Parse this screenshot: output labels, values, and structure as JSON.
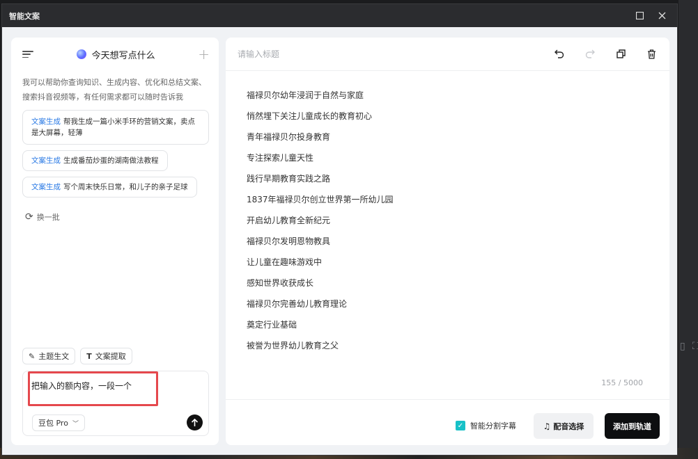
{
  "window": {
    "title": "智能文案"
  },
  "left": {
    "header_title": "今天想写点什么",
    "intro": "我可以帮助你查询知识、生成内容、优化和总结文案、搜索抖音视频等，有任何需求都可以随时告诉我",
    "suggestions": [
      {
        "tag": "文案生成",
        "text": "帮我生成一篇小米手环的营销文案，卖点是大屏幕，轻薄"
      },
      {
        "tag": "文案生成",
        "text": "生成番茄炒蛋的湖南做法教程"
      },
      {
        "tag": "文案生成",
        "text": "写个周末快乐日常，和儿子的亲子足球"
      }
    ],
    "refresh_label": "换一批",
    "chips": [
      {
        "label": "主题生文"
      },
      {
        "label": "文案提取"
      }
    ],
    "input_text": "把输入的额内容，一段一个",
    "model": "豆包 Pro"
  },
  "right": {
    "title_placeholder": "请输入标题",
    "lines": [
      "福禄贝尔幼年浸润于自然与家庭",
      "悄然埋下关注儿童成长的教育初心",
      "青年福禄贝尔投身教育",
      "专注探索儿童天性",
      "践行早期教育实践之路",
      "1837年福禄贝尔创立世界第一所幼儿园",
      "开启幼儿教育全新纪元",
      "福禄贝尔发明恩物教具",
      "让儿童在趣味游戏中",
      "感知世界收获成长",
      "福禄贝尔完善幼儿教育理论",
      "奠定行业基础",
      "被誉为世界幼儿教育之父"
    ],
    "counter": "155 / 5000",
    "smart_subtitle_label": "智能分割字幕",
    "voice_button": "配音选择",
    "add_button": "添加到轨道"
  },
  "colors": {
    "accent_teal": "#18c1c8",
    "tag_blue": "#2c7be5",
    "highlight_red": "#e5484d"
  },
  "icons": [
    "menu-icon",
    "plus-icon",
    "refresh-icon",
    "undo-icon",
    "redo-icon",
    "copy-icon",
    "trash-icon",
    "send-icon",
    "maximize-icon",
    "close-icon"
  ]
}
